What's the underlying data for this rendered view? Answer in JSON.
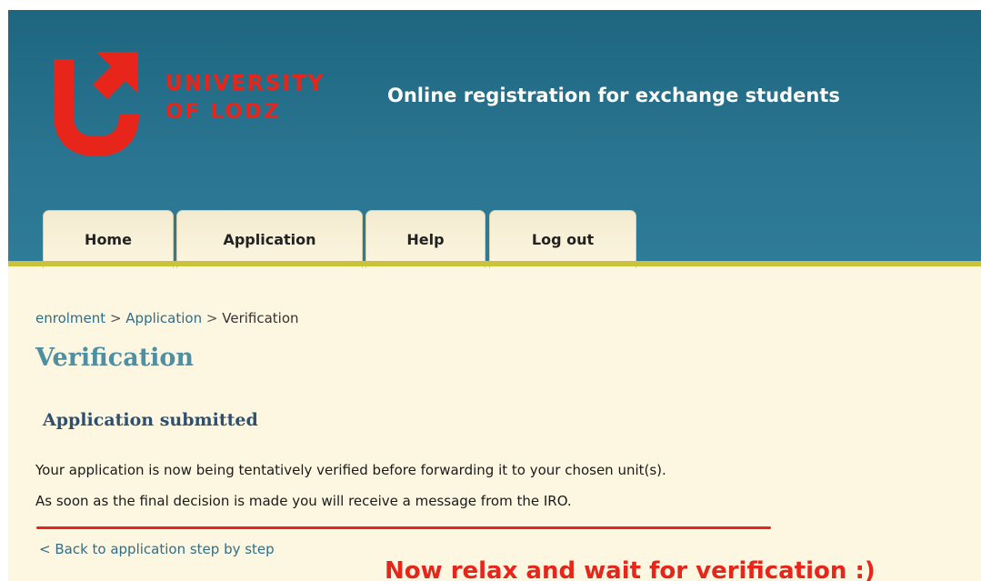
{
  "header": {
    "logo_line1": "UNIVERSITY",
    "logo_line2": "OF LODZ",
    "site_title": "Online registration for exchange students",
    "brand_color": "#e8251a"
  },
  "tabs": [
    {
      "label": "Home"
    },
    {
      "label": "Application"
    },
    {
      "label": "Help"
    },
    {
      "label": "Log out"
    }
  ],
  "breadcrumb": {
    "items": [
      "enrolment",
      "Application",
      "Verification"
    ],
    "separator": ">"
  },
  "page": {
    "title": "Verification",
    "subtitle": "Application submitted",
    "paragraph1": "Your application is now being tentatively verified before forwarding it to your chosen unit(s).",
    "paragraph2": "As soon as the final decision is made you will receive a message from the IRO.",
    "back_link": "< Back to application step by step"
  },
  "annotation": {
    "note": "Now relax and wait for verification :)"
  }
}
